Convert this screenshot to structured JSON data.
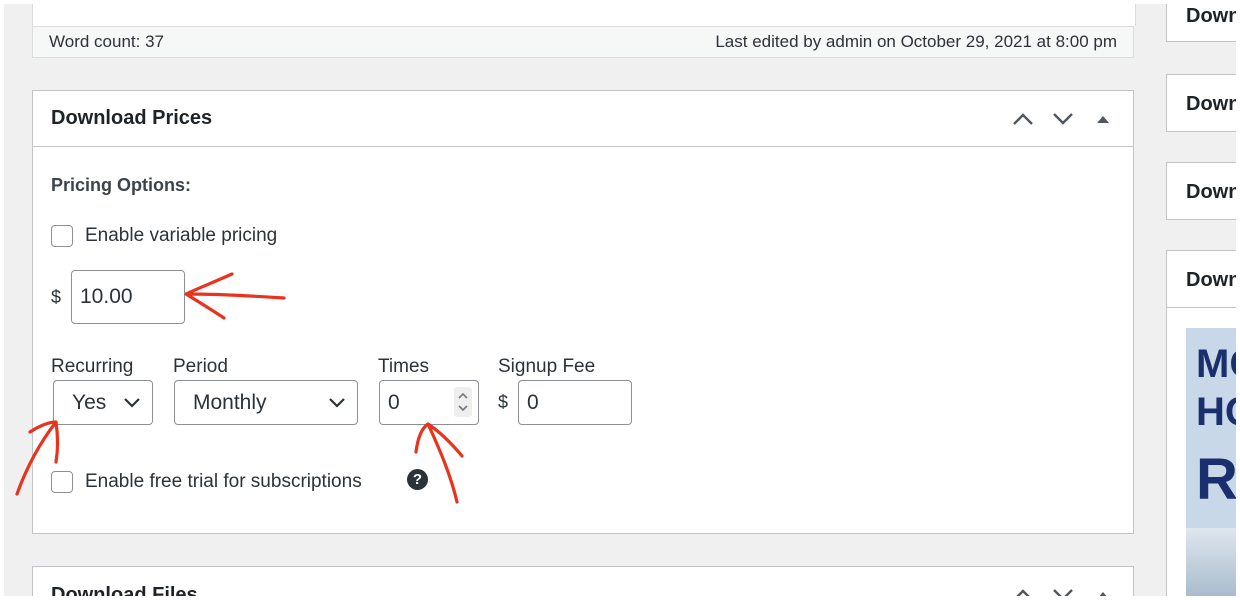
{
  "status_bar": {
    "word_count": "Word count: 37",
    "last_edited": "Last edited by admin on October 29, 2021 at 8:00 pm"
  },
  "download_prices": {
    "title": "Download Prices",
    "pricing_options_label": "Pricing Options:",
    "variable_pricing_label": "Enable variable pricing",
    "variable_pricing_checked": false,
    "currency_symbol": "$",
    "price_value": "10.00",
    "recurring_label": "Recurring",
    "recurring_value": "Yes",
    "period_label": "Period",
    "period_value": "Monthly",
    "times_label": "Times",
    "times_value": "0",
    "signup_fee_label": "Signup Fee",
    "signup_fee_currency": "$",
    "signup_fee_value": "0",
    "free_trial_label": "Enable free trial for subscriptions",
    "free_trial_checked": false,
    "help_glyph": "?"
  },
  "download_files": {
    "title": "Download Files"
  },
  "sidebar": {
    "boxes": [
      {
        "title": "Down"
      },
      {
        "title": "Down"
      },
      {
        "title": "Down"
      },
      {
        "title": "Down"
      }
    ],
    "poster_text": [
      "MO",
      "HO",
      "R"
    ]
  },
  "icons": {
    "move_up": "chevron-up-icon",
    "move_down": "chevron-down-icon",
    "toggle": "triangle-up-icon",
    "help": "help-circle-icon"
  },
  "colors": {
    "annotation": "#e8341c",
    "panel_border": "#c3c4c7",
    "background": "#f0f0f1"
  }
}
